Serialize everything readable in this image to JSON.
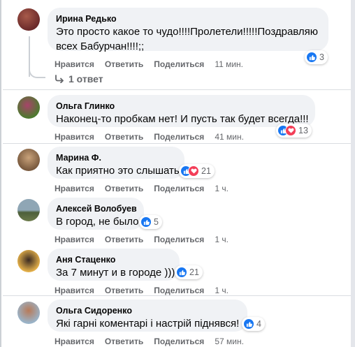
{
  "comments": [
    {
      "author": "Ирина Редько",
      "line1": "Это просто какое то чудо!!!!Пролетели!!!!!Поздравляю",
      "line2": "всех Бабурчан!!!!;;",
      "reactions": "3",
      "like": "Нравится",
      "reply": "Ответить",
      "share": "Поделиться",
      "time": "11 мин.",
      "replies": "1 ответ",
      "avatar_colors": [
        "#6b2a2a",
        "#a85a4a"
      ]
    },
    {
      "author": "Ольга Глинко",
      "line1": "Наконец-то пробкам нет! И пусть так будет всегда!!!",
      "reactions": "13",
      "like": "Нравится",
      "reply": "Ответить",
      "share": "Поделиться",
      "time": "41 мин.",
      "avatar_colors": [
        "#4c7a2e",
        "#a8446a"
      ]
    },
    {
      "author": "Марина Ф.",
      "line1": "Как приятно это слышать",
      "reactions": "21",
      "like": "Нравится",
      "reply": "Ответить",
      "share": "Поделиться",
      "time": "1 ч.",
      "avatar_colors": [
        "#c9a27a",
        "#7a5a3e"
      ]
    },
    {
      "author": "Алексей Волобуев",
      "line1": "В город, не было",
      "reactions": "5",
      "like": "Нравится",
      "reply": "Ответить",
      "share": "Поделиться",
      "time": "1 ч.",
      "avatar_colors": [
        "#8fa6b5",
        "#4d5f3a"
      ]
    },
    {
      "author": "Аня Стаценко",
      "line1": "За 7 минут и в городе )))",
      "reactions": "21",
      "like": "Нравится",
      "reply": "Ответить",
      "share": "Поделиться",
      "time": "1 ч.",
      "avatar_colors": [
        "#e4b04a",
        "#3a2a22"
      ]
    },
    {
      "author": "Ольга Сидоренко",
      "line1": "Які гарні коментарі і настрій піднявся!",
      "reactions": "4",
      "like": "Нравится",
      "reply": "Ответить",
      "share": "Поделиться",
      "time": "57 мин.",
      "avatar_colors": [
        "#9ab3c8",
        "#b87a58"
      ]
    }
  ],
  "icons": {
    "like": "thumbs-up-icon",
    "love": "heart-icon",
    "reply_arrow": "reply-arrow-icon"
  },
  "colors": {
    "accent": "#1877f2",
    "love": "#f33e58",
    "bubble": "#f0f2f5",
    "secondary_text": "#65676b"
  }
}
